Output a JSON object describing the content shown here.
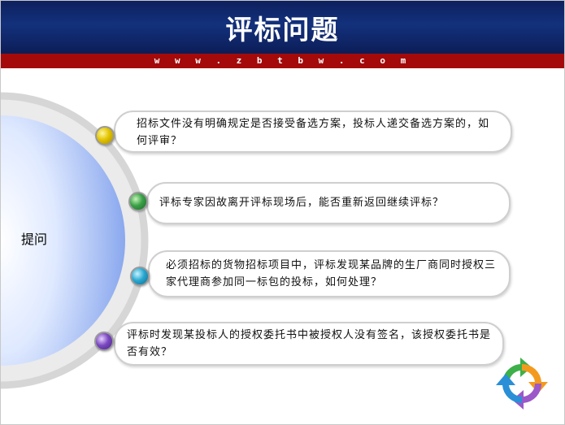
{
  "header": {
    "title": "评标问题",
    "url": "w w w . z b t b w . c o m"
  },
  "side_label": "提问",
  "questions": [
    {
      "text": "招标文件没有明确规定是否接受备选方案，投标人递交备选方案的，如何评审？",
      "dot_color": "#e2c400"
    },
    {
      "text": "评标专家因故离开评标现场后，能否重新返回继续评标？",
      "dot_color": "#3aa048"
    },
    {
      "text": "必须招标的货物招标项目中，评标发现某品牌的生厂商同时授权三家代理商参加同一标包的投标，如何处理？",
      "dot_color": "#2aa8d0"
    },
    {
      "text": "评标时发现某投标人的授权委托书中被授权人没有签名，该授权委托书是否有效？",
      "dot_color": "#7a48c0"
    }
  ],
  "colors": {
    "header_bg": "#13317c",
    "url_bar_bg": "#a40a0a",
    "bubble_border": "#cfcfcf"
  },
  "icons": [
    "cycle-arrows-icon"
  ]
}
